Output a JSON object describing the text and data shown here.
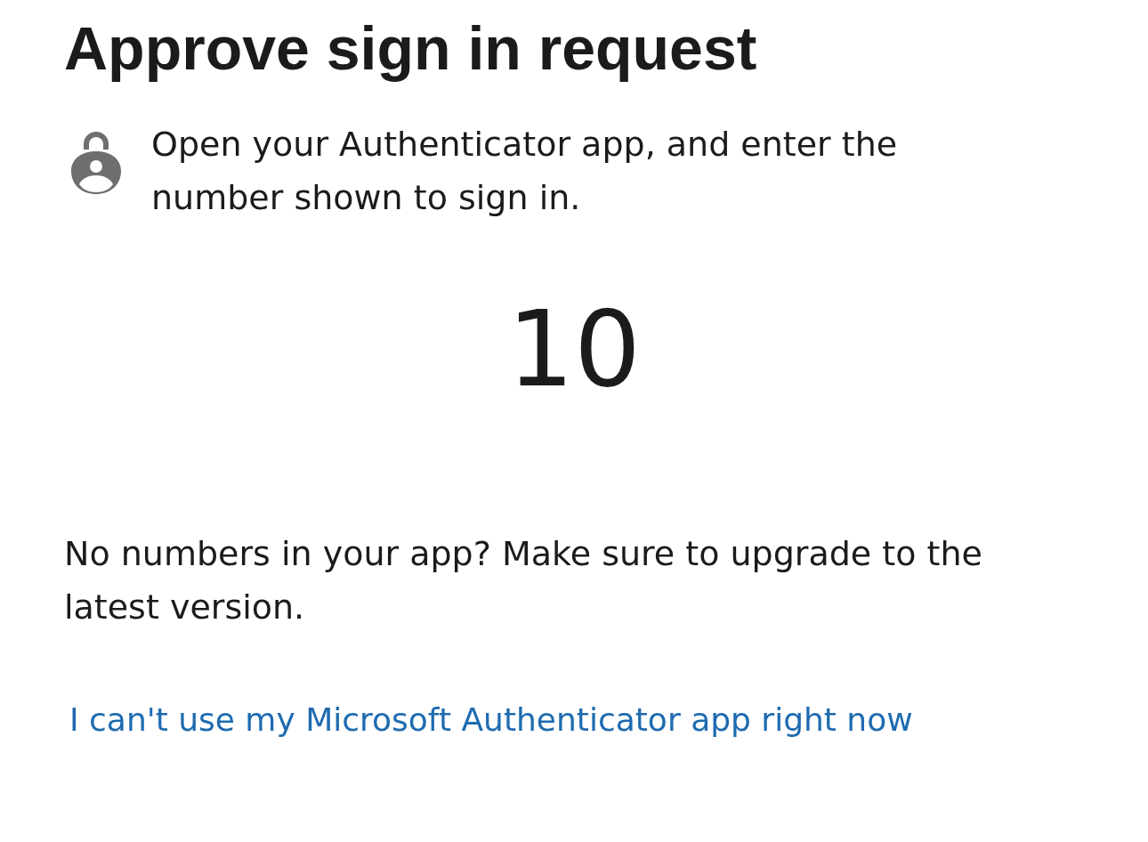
{
  "title": "Approve sign in request",
  "instruction": "Open your Authenticator app, and enter the number shown to sign in.",
  "number": "10",
  "note": "No numbers in your app? Make sure to upgrade to the latest version.",
  "link": "I can't use my Microsoft Authenticator app right now"
}
